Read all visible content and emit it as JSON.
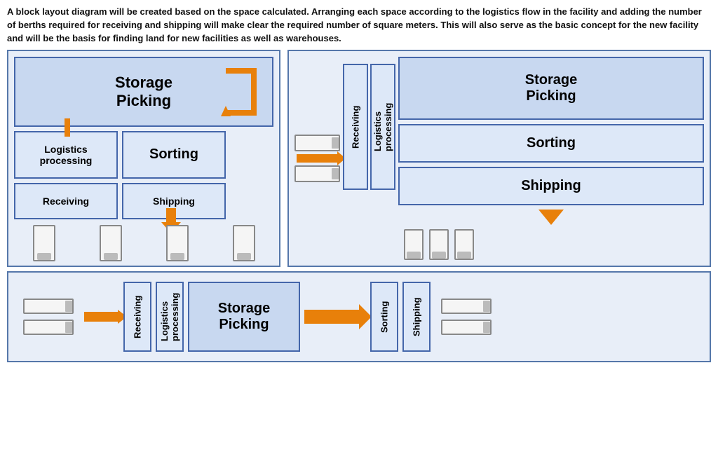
{
  "description": "A block layout diagram will be created based on the space calculated. Arranging each space according to the logistics flow in the facility and adding the number of berths required for receiving and shipping will make clear the required number of square meters. This will also serve as the basic concept for the new facility and will be the basis for finding land for new facilities as well as warehouses.",
  "diagram_left": {
    "storage_picking": "Storage\nPicking",
    "logistics_processing": "Logistics\nprocessing",
    "sorting": "Sorting",
    "receiving": "Receiving",
    "shipping": "Shipping"
  },
  "diagram_right": {
    "receiving": "Receiving",
    "logistics_processing": "Logistics\nprocessing",
    "storage_picking": "Storage\nPicking",
    "sorting": "Sorting",
    "shipping": "Shipping"
  },
  "diagram_bottom": {
    "receiving": "Receiving",
    "logistics_processing": "Logistics\nprocessing",
    "storage_picking": "Storage\nPicking",
    "sorting": "Sorting",
    "shipping": "Shipping"
  }
}
